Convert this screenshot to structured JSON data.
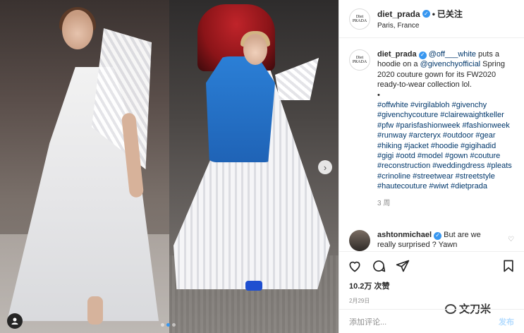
{
  "post": {
    "account": "diet_prada",
    "avatar_text": "Diet PRADA",
    "separator": "•",
    "follow_label": "已关注",
    "location": "Paris, France",
    "caption": {
      "author": "diet_prada",
      "mention": "@off___white",
      "text_1": " puts a hoodie on a ",
      "mention_2": "@givenchyofficial",
      "text_2": " Spring 2020 couture gown for its FW2020 ready-to-wear collection lol.",
      "bullet": "•",
      "hashtags": "#offwhite #virgilabloh #givenchy #givenchycouture #clairewaightkeller #pfw #parisfashionweek #fashionweek #runway #arcteryx #outdoor #gear #hiking #jacket #hoodie #gigihadid #gigi #ootd #model #gown #couture #reconstruction #weddingdress #pleats #crinoline #streetwear #streetstyle #hautecouture #wiwt #dietprada"
    },
    "caption_age": "3 周",
    "reply": {
      "author": "ashtonmichael",
      "text": " But are we really surprised ? Yawn"
    },
    "likes": "10.2万 次赞",
    "date": "2月29日",
    "comment_placeholder": "添加评论...",
    "post_label": "发布",
    "watermark": "文刀米",
    "carousel": {
      "count": 3,
      "active_index": 1
    }
  },
  "colors": {
    "link": "#00376b",
    "verified": "#3897f0",
    "post_button": "#b3dbff",
    "muted": "#8e8e8e"
  },
  "icons": [
    "verified-badge-icon",
    "heart-icon",
    "comment-icon",
    "share-icon",
    "bookmark-icon",
    "chevron-right-icon",
    "user-tag-icon",
    "heart-small-icon"
  ]
}
